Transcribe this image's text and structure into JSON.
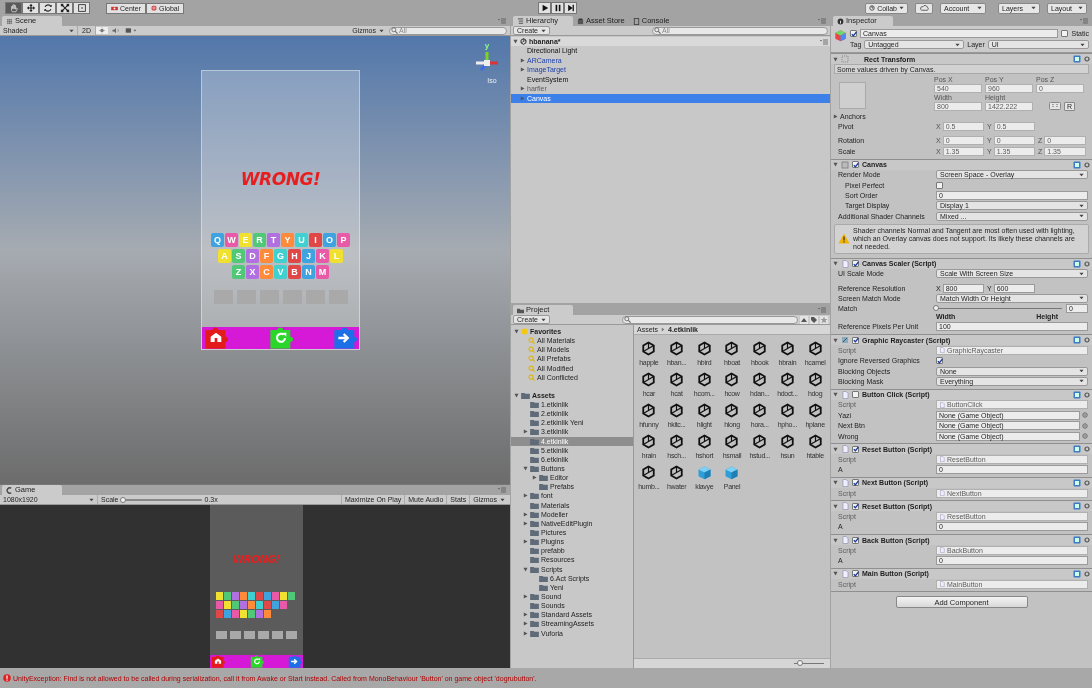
{
  "toolbar": {
    "tools": [
      {
        "kind": "hand",
        "selected": true
      },
      {
        "kind": "move",
        "selected": false
      },
      {
        "kind": "rotate",
        "selected": false
      },
      {
        "kind": "scale",
        "selected": false
      },
      {
        "kind": "rect",
        "selected": false
      }
    ],
    "pivot": [
      {
        "kind": "pivot",
        "label": "Center"
      },
      {
        "kind": "space",
        "label": "Global"
      }
    ],
    "playback": [
      {
        "kind": "play"
      },
      {
        "kind": "pause"
      },
      {
        "kind": "step"
      }
    ],
    "collab": "Collab",
    "account": "Account",
    "layers": "Layers",
    "layout": "Layout"
  },
  "scene": {
    "tab": "Scene",
    "shading": "Shaded",
    "mode_2d": {
      "label": "2D",
      "on": false
    },
    "gizmos": "Gizmos",
    "search_placeholder": "All",
    "gizmo_axis": "y",
    "projection": "Iso",
    "preview": {
      "message": "WRONG!",
      "keys": [
        [
          "Q",
          "W",
          "E",
          "R",
          "T",
          "Y",
          "U",
          "I",
          "O",
          "P"
        ],
        [
          "A",
          "S",
          "D",
          "F",
          "G",
          "H",
          "J",
          "K",
          "L"
        ],
        [
          "Z",
          "X",
          "C",
          "V",
          "B",
          "N",
          "M"
        ]
      ]
    }
  },
  "game": {
    "tab": "Game",
    "resolution": "1080x1920",
    "scale_label": "Scale",
    "scale": {
      "level": 0.02
    },
    "scale_value": "0.3x",
    "toggles": [
      {
        "label": "Maximize On Play",
        "on": false
      },
      {
        "label": "Mute Audio",
        "on": false
      },
      {
        "label": "Stats",
        "on": false
      }
    ],
    "gizmos": "Gizmos",
    "message": "WRONG!"
  },
  "hierarchy": {
    "tabs": [
      {
        "label": "Hierarchy",
        "kind": "hierarchy",
        "selected": true
      },
      {
        "label": "Asset Store",
        "kind": "store",
        "selected": false
      },
      {
        "label": "Console",
        "kind": "console",
        "selected": false
      }
    ],
    "create": "Create",
    "search_placeholder": "All",
    "scene": "hbanana*",
    "items": [
      {
        "label": "Directional Light",
        "kind": "object",
        "expandable": false,
        "selected": false
      },
      {
        "label": "ARCamera",
        "kind": "prefab",
        "expandable": true,
        "selected": false
      },
      {
        "label": "ImageTarget",
        "kind": "prefab",
        "expandable": true,
        "selected": false
      },
      {
        "label": "EventSystem",
        "kind": "object",
        "expandable": false,
        "selected": false
      },
      {
        "label": "harfler",
        "kind": "inactive",
        "expandable": true,
        "selected": false
      },
      {
        "label": "Canvas",
        "kind": "object",
        "expandable": true,
        "selected": true
      }
    ]
  },
  "project": {
    "tab": "Project",
    "create": "Create",
    "favorites": {
      "label": "Favorites",
      "expanded": true,
      "items": [
        {
          "label": "All Materials",
          "selected": false
        },
        {
          "label": "All Models",
          "selected": false
        },
        {
          "label": "All Prefabs",
          "selected": false
        },
        {
          "label": "All Modified",
          "selected": false
        },
        {
          "label": "All Conflicted",
          "selected": false
        }
      ]
    },
    "assets": {
      "label": "Assets",
      "expanded": true,
      "selected": false,
      "children": [
        {
          "label": "1.etkinlik",
          "selected": false
        },
        {
          "label": "2.etkinlik",
          "selected": false
        },
        {
          "label": "2.etkinlik Yeni",
          "selected": false
        },
        {
          "label": "3.etkinlik",
          "expanded": false,
          "selected": false
        },
        {
          "label": "4.etkinlik",
          "selected": true
        },
        {
          "label": "5.etkinlik",
          "selected": false
        },
        {
          "label": "6.etkinlik",
          "selected": false
        },
        {
          "label": "Buttons",
          "expanded": true,
          "selected": false,
          "children": [
            {
              "label": "Editor",
              "expanded": false,
              "selected": false
            },
            {
              "label": "Prefabs",
              "selected": false
            }
          ]
        },
        {
          "label": "font",
          "expanded": false,
          "selected": false
        },
        {
          "label": "Materials",
          "selected": false
        },
        {
          "label": "Modeller",
          "expanded": false,
          "selected": false
        },
        {
          "label": "NativeEditPlugin",
          "expanded": false,
          "selected": false
        },
        {
          "label": "Pictures",
          "selected": false
        },
        {
          "label": "Plugins",
          "expanded": false,
          "selected": false
        },
        {
          "label": "prefabb",
          "selected": false
        },
        {
          "label": "Resources",
          "selected": false
        },
        {
          "label": "Scripts",
          "expanded": true,
          "selected": false,
          "children": [
            {
              "label": "6.Act Scripts",
              "selected": false
            },
            {
              "label": "Yeni",
              "selected": false
            }
          ]
        },
        {
          "label": "Sound",
          "expanded": false,
          "selected": false
        },
        {
          "label": "Sounds",
          "selected": false
        },
        {
          "label": "Standard Assets",
          "expanded": false,
          "selected": false
        },
        {
          "label": "StreamingAssets",
          "expanded": false,
          "selected": false
        },
        {
          "label": "Vuforia",
          "expanded": false,
          "selected": false
        }
      ]
    },
    "breadcrumb": [
      "Assets",
      "4.etkinlik"
    ],
    "files": [
      {
        "name": "happle",
        "kind": "scene"
      },
      {
        "name": "hban...",
        "kind": "scene"
      },
      {
        "name": "hbird",
        "kind": "scene"
      },
      {
        "name": "hboat",
        "kind": "scene"
      },
      {
        "name": "hbook",
        "kind": "scene"
      },
      {
        "name": "hbrain",
        "kind": "scene"
      },
      {
        "name": "hcamel",
        "kind": "scene"
      },
      {
        "name": "hcar",
        "kind": "scene"
      },
      {
        "name": "hcat",
        "kind": "scene"
      },
      {
        "name": "hcom...",
        "kind": "scene"
      },
      {
        "name": "hcow",
        "kind": "scene"
      },
      {
        "name": "hdan...",
        "kind": "scene"
      },
      {
        "name": "hdoct...",
        "kind": "scene"
      },
      {
        "name": "hdog",
        "kind": "scene"
      },
      {
        "name": "hfunny",
        "kind": "scene"
      },
      {
        "name": "hkitc...",
        "kind": "scene"
      },
      {
        "name": "hlight",
        "kind": "scene"
      },
      {
        "name": "hlong",
        "kind": "scene"
      },
      {
        "name": "hora...",
        "kind": "scene"
      },
      {
        "name": "hpho...",
        "kind": "scene"
      },
      {
        "name": "hplane",
        "kind": "scene"
      },
      {
        "name": "hrain",
        "kind": "scene"
      },
      {
        "name": "hsch...",
        "kind": "scene"
      },
      {
        "name": "hshort",
        "kind": "scene"
      },
      {
        "name": "hsmall",
        "kind": "scene"
      },
      {
        "name": "hstud...",
        "kind": "scene"
      },
      {
        "name": "hsun",
        "kind": "scene"
      },
      {
        "name": "htable",
        "kind": "scene"
      },
      {
        "name": "humb...",
        "kind": "scene"
      },
      {
        "name": "hwater",
        "kind": "scene"
      },
      {
        "name": "klavye",
        "kind": "prefab"
      },
      {
        "name": "Panel",
        "kind": "prefab"
      }
    ],
    "icon_size": {
      "level": 0.2
    }
  },
  "inspector": {
    "tab": "Inspector",
    "object": {
      "active": true,
      "name": "Canvas",
      "static_label": "Static",
      "static": false,
      "tag_label": "Tag",
      "tag": "Untagged",
      "layer_label": "Layer",
      "layer": "UI"
    },
    "rect_transform": {
      "title": "Rect Transform",
      "driven": true,
      "note": "Some values driven by Canvas.",
      "position": [
        {
          "label": "Pos X",
          "value": "540"
        },
        {
          "label": "Pos Y",
          "value": "960"
        },
        {
          "label": "Pos Z",
          "value": "0"
        }
      ],
      "size": [
        {
          "label": "Width",
          "value": "800"
        },
        {
          "label": "Height",
          "value": "1422.222"
        }
      ],
      "raw_button": "R",
      "rows": [
        {
          "label": "Anchors",
          "kind": "foldout"
        },
        {
          "label": "Pivot",
          "kind": "vector",
          "values": [
            {
              "axis": "X",
              "value": "0.5"
            },
            {
              "axis": "Y",
              "value": "0.5"
            }
          ]
        },
        {
          "label": "Rotation",
          "kind": "vector",
          "values": [
            {
              "axis": "X",
              "value": "0"
            },
            {
              "axis": "Y",
              "value": "0"
            },
            {
              "axis": "Z",
              "value": "0"
            }
          ]
        },
        {
          "label": "Scale",
          "kind": "vector",
          "values": [
            {
              "axis": "X",
              "value": "1.35"
            },
            {
              "axis": "Y",
              "value": "1.35"
            },
            {
              "axis": "Z",
              "value": "1.35"
            }
          ]
        }
      ]
    },
    "components": [
      {
        "title": "Canvas",
        "kind": "canvas",
        "enabled": true,
        "fields": [
          {
            "label": "Render Mode",
            "kind": "dropdown",
            "value": "Screen Space - Overlay",
            "children": [
              {
                "label": "Pixel Perfect",
                "kind": "checkbox",
                "checked": false
              },
              {
                "label": "Sort Order",
                "kind": "text",
                "value": "0"
              },
              {
                "label": "Target Display",
                "kind": "dropdown",
                "value": "Display 1"
              }
            ]
          },
          {
            "label": "Additional Shader Channels",
            "kind": "dropdown",
            "value": "Mixed ..."
          },
          {
            "kind": "warning",
            "text": "Shader channels Normal and Tangent are most often used with lighting, which an Overlay canvas does not support. Its likely these channels are not needed."
          }
        ]
      },
      {
        "title": "Canvas Scaler (Script)",
        "kind": "script",
        "enabled": true,
        "fields": [
          {
            "label": "UI Scale Mode",
            "kind": "dropdown",
            "value": "Scale With Screen Size"
          },
          {
            "label": "Reference Resolution",
            "kind": "vector",
            "values": [
              {
                "axis": "X",
                "value": "800"
              },
              {
                "axis": "Y",
                "value": "600"
              }
            ]
          },
          {
            "label": "Screen Match Mode",
            "kind": "dropdown",
            "value": "Match Width Or Height"
          },
          {
            "label": "Match",
            "kind": "slider",
            "level": 0,
            "value": "0",
            "min_label": "Width",
            "max_label": "Height"
          },
          {
            "label": "Reference Pixels Per Unit",
            "kind": "text",
            "value": "100"
          }
        ]
      },
      {
        "title": "Graphic Raycaster (Script)",
        "kind": "raycaster",
        "enabled": true,
        "fields": [
          {
            "label": "Script",
            "kind": "script",
            "value": "GraphicRaycaster"
          },
          {
            "label": "Ignore Reversed Graphics",
            "kind": "checkbox",
            "checked": true
          },
          {
            "label": "Blocking Objects",
            "kind": "dropdown",
            "value": "None"
          },
          {
            "label": "Blocking Mask",
            "kind": "dropdown",
            "value": "Everything"
          }
        ]
      },
      {
        "title": "Button Click (Script)",
        "kind": "script",
        "enabled": false,
        "fields": [
          {
            "label": "Script",
            "kind": "script",
            "value": "ButtonClick"
          },
          {
            "label": "Yazi",
            "kind": "object",
            "value": "None (Game Object)"
          },
          {
            "label": "Next Btn",
            "kind": "object",
            "value": "None (Game Object)"
          },
          {
            "label": "Wrong",
            "kind": "object",
            "value": "None (Game Object)"
          }
        ]
      },
      {
        "title": "Reset Button (Script)",
        "kind": "script",
        "enabled": true,
        "fields": [
          {
            "label": "Script",
            "kind": "script",
            "value": "ResetButton"
          },
          {
            "label": "A",
            "kind": "text",
            "value": "0"
          }
        ]
      },
      {
        "title": "Next Button (Script)",
        "kind": "script",
        "enabled": true,
        "fields": [
          {
            "label": "Script",
            "kind": "script",
            "value": "NextButton"
          }
        ]
      },
      {
        "title": "Reset Button (Script)",
        "kind": "script",
        "enabled": true,
        "fields": [
          {
            "label": "Script",
            "kind": "script",
            "value": "ResetButton"
          },
          {
            "label": "A",
            "kind": "text",
            "value": "0"
          }
        ]
      },
      {
        "title": "Back Button (Script)",
        "kind": "script",
        "enabled": true,
        "fields": [
          {
            "label": "Script",
            "kind": "script",
            "value": "BackButton"
          },
          {
            "label": "A",
            "kind": "text",
            "value": "0"
          }
        ]
      },
      {
        "title": "Main Button (Script)",
        "kind": "script",
        "enabled": true,
        "fields": [
          {
            "label": "Script",
            "kind": "script",
            "value": "MainButton"
          }
        ]
      }
    ],
    "add_component": "Add Component"
  },
  "status_bar": {
    "kind": "error",
    "message": "UnityException: Find is not allowed to be called during serialization, call it from Awake or Start instead. Called from MonoBehaviour 'Button' on game object 'dogrubutton'."
  }
}
